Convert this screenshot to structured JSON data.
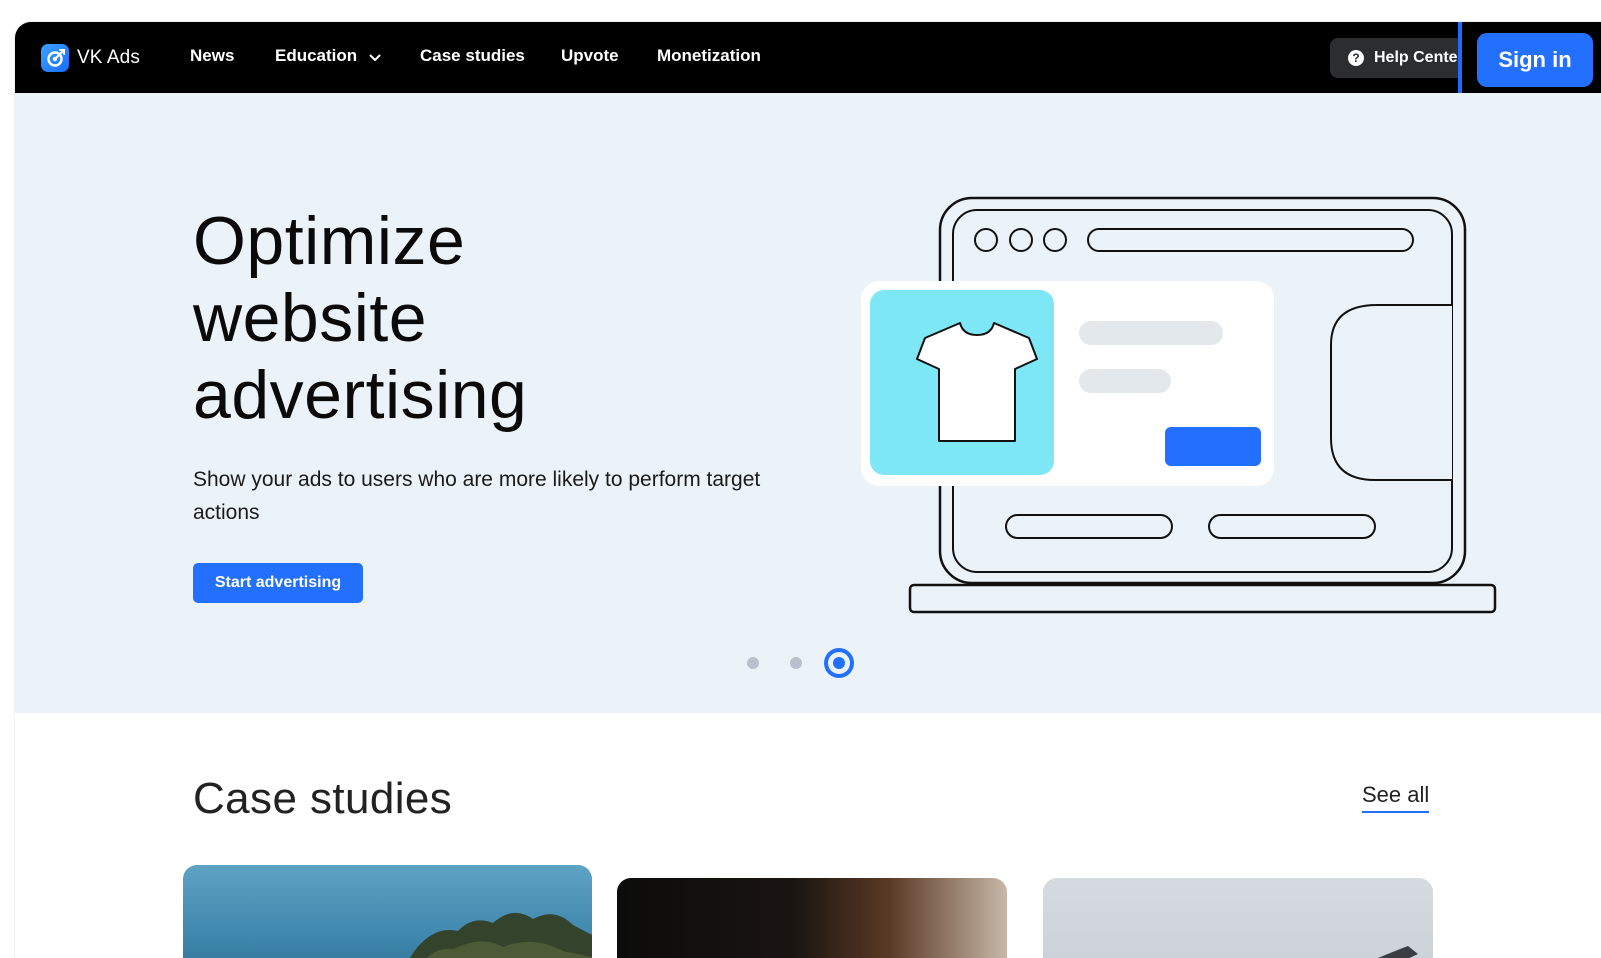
{
  "brand": {
    "name": "VK Ads",
    "accent": "#2370ff"
  },
  "nav": {
    "items": [
      {
        "label": "News"
      },
      {
        "label": "Education",
        "has_dropdown": true
      },
      {
        "label": "Case studies"
      },
      {
        "label": "Upvote"
      },
      {
        "label": "Monetization"
      }
    ],
    "help_label": "Help Center",
    "signin_label": "Sign in"
  },
  "hero": {
    "title_lines": [
      "Optimize",
      "website",
      "advertising"
    ],
    "subtitle": "Show your ads to users who are more likely to perform target actions",
    "cta_label": "Start advertising",
    "carousel": {
      "count": 3,
      "active_index": 2
    }
  },
  "case_studies": {
    "title": "Case studies",
    "see_all_label": "See all"
  },
  "icons": {
    "logo": "vk-ads-logo-icon",
    "chevron": "chevron-down-icon",
    "help": "question-circle-icon",
    "shirt": "t-shirt-icon"
  },
  "colors": {
    "nav_bg": "#000000",
    "hero_bg": "#ebf3f9",
    "product_tile": "#7de7f5"
  }
}
